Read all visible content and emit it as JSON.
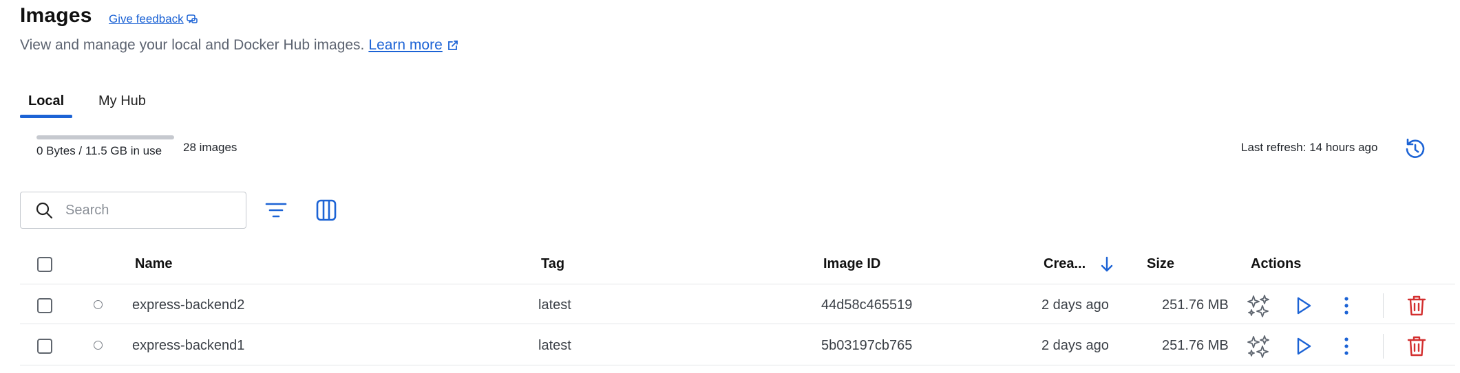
{
  "header": {
    "title": "Images",
    "feedback_label": "Give feedback",
    "subtitle": "View and manage your local and Docker Hub images.",
    "learn_more": "Learn more"
  },
  "tabs": [
    {
      "label": "Local",
      "active": true
    },
    {
      "label": "My Hub",
      "active": false
    }
  ],
  "usage": {
    "text": "0 Bytes / 11.5 GB in use",
    "fraction_used": 0,
    "count": "28 images"
  },
  "refresh": {
    "text": "Last refresh: 14 hours ago"
  },
  "search": {
    "placeholder": "Search",
    "value": ""
  },
  "table": {
    "columns": {
      "name": "Name",
      "tag": "Tag",
      "image_id": "Image ID",
      "created": "Crea...",
      "size": "Size",
      "actions": "Actions"
    },
    "sort": {
      "column": "created",
      "direction": "descending"
    },
    "rows": [
      {
        "name": "express-backend2",
        "tag": "latest",
        "image_id": "44d58c465519",
        "created": "2 days ago",
        "size": "251.76 MB"
      },
      {
        "name": "express-backend1",
        "tag": "latest",
        "image_id": "5b03197cb765",
        "created": "2 days ago",
        "size": "251.76 MB"
      }
    ]
  },
  "icons": {
    "feedback": "feedback-icon",
    "external_link": "external-link-icon",
    "refresh": "refresh-icon",
    "search": "search-icon",
    "filter": "filter-icon",
    "columns": "columns-icon",
    "sort": "arrow-down-icon",
    "status": "circle-icon",
    "recommendations": "sparkles-icon",
    "run": "play-icon",
    "more": "kebab-menu-icon",
    "delete": "trash-icon"
  },
  "colors": {
    "accent": "#1c63d5",
    "danger": "#d32f2f",
    "text": "#1f2329",
    "muted": "#5c6370",
    "usage_track": "#c6c9cf"
  }
}
